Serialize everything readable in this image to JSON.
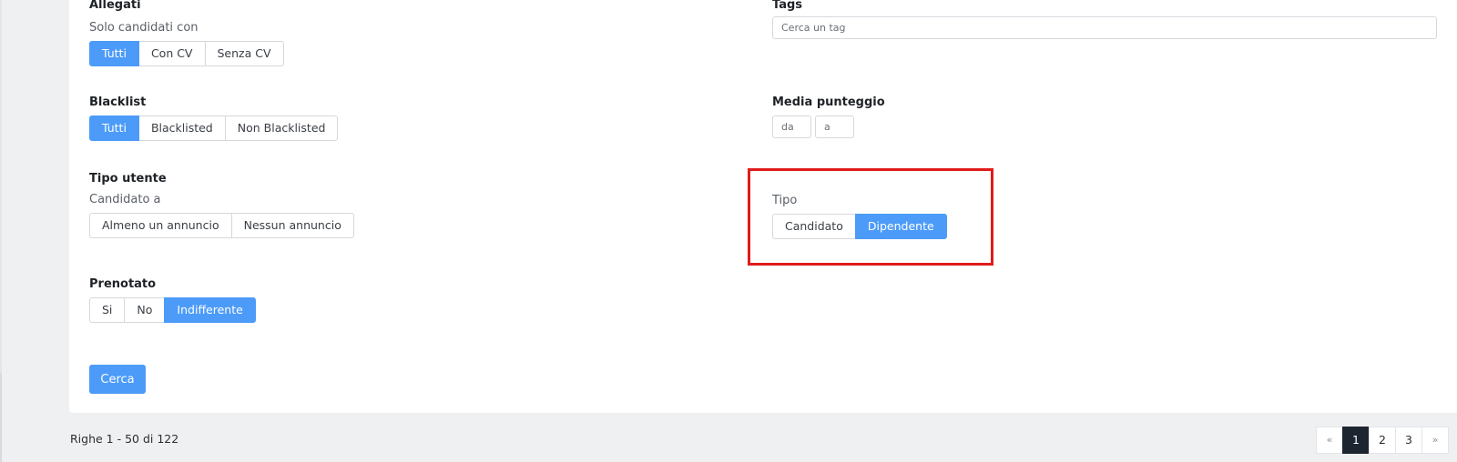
{
  "filters": {
    "allegati": {
      "title": "Allegati",
      "subtitle": "Solo candidati con",
      "options": [
        "Tutti",
        "Con CV",
        "Senza CV"
      ],
      "selected": "Tutti"
    },
    "tags": {
      "title": "Tags",
      "placeholder": "Cerca un tag"
    },
    "blacklist": {
      "title": "Blacklist",
      "options": [
        "Tutti",
        "Blacklisted",
        "Non Blacklisted"
      ],
      "selected": "Tutti"
    },
    "media_punteggio": {
      "title": "Media punteggio",
      "from_placeholder": "da",
      "to_placeholder": "a"
    },
    "tipo_utente": {
      "title": "Tipo utente",
      "subtitle": "Candidato a",
      "options": [
        "Almeno un annuncio",
        "Nessun annuncio"
      ],
      "selected": ""
    },
    "tipo": {
      "subtitle": "Tipo",
      "options": [
        "Candidato",
        "Dipendente"
      ],
      "selected": "Dipendente"
    },
    "prenotato": {
      "title": "Prenotato",
      "options": [
        "Si",
        "No",
        "Indifferente"
      ],
      "selected": "Indifferente"
    }
  },
  "search_button": "Cerca",
  "rows_info": "Righe 1 - 50 di 122",
  "pagination": {
    "prev": "«",
    "pages": [
      "1",
      "2",
      "3"
    ],
    "current": "1",
    "next": "»"
  },
  "colors": {
    "accent": "#4c9bf8",
    "highlight": "#e01b1b",
    "page_current": "#1c2530"
  }
}
